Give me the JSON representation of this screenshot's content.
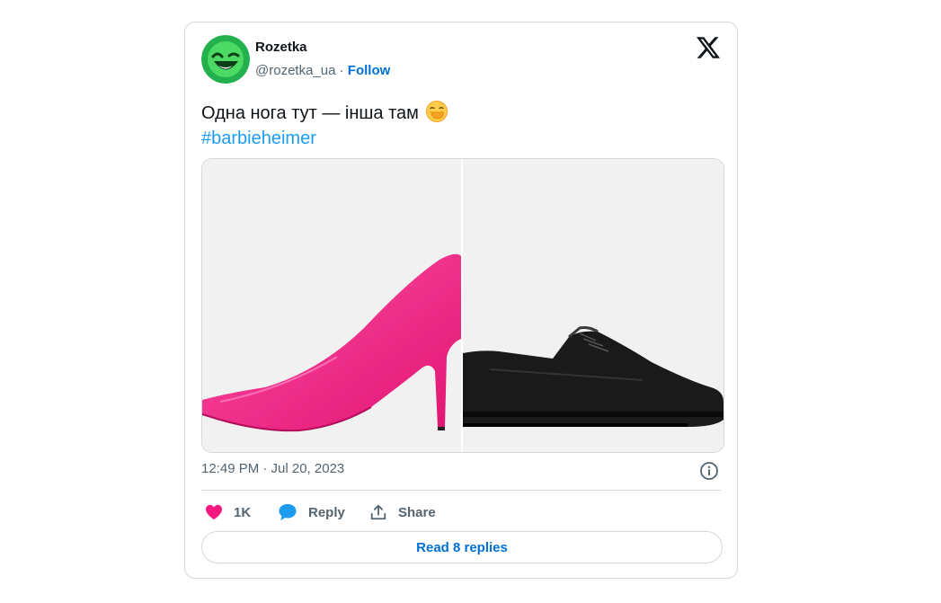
{
  "author": {
    "name": "Rozetka",
    "handle": "@rozetka_ua",
    "separator": " · ",
    "follow_label": "Follow"
  },
  "tweet": {
    "text": "Одна нога тут — інша там",
    "emoji": "face-with-hand-over-mouth",
    "hashtag": "#barbieheimer",
    "timestamp": "12:49 PM · Jul 20, 2023"
  },
  "media": {
    "left_image": "pink-stiletto-heel",
    "right_image": "black-leather-oxford-shoe"
  },
  "actions": {
    "like_count": "1K",
    "reply_label": "Reply",
    "share_label": "Share"
  },
  "read_replies_label": "Read 8 replies",
  "colors": {
    "accent": "#006fd6",
    "hashtag": "#1d9bf0",
    "like": "#f91880",
    "avatar_green": "#22b14c",
    "muted": "#536471",
    "border": "#cfd9de"
  }
}
